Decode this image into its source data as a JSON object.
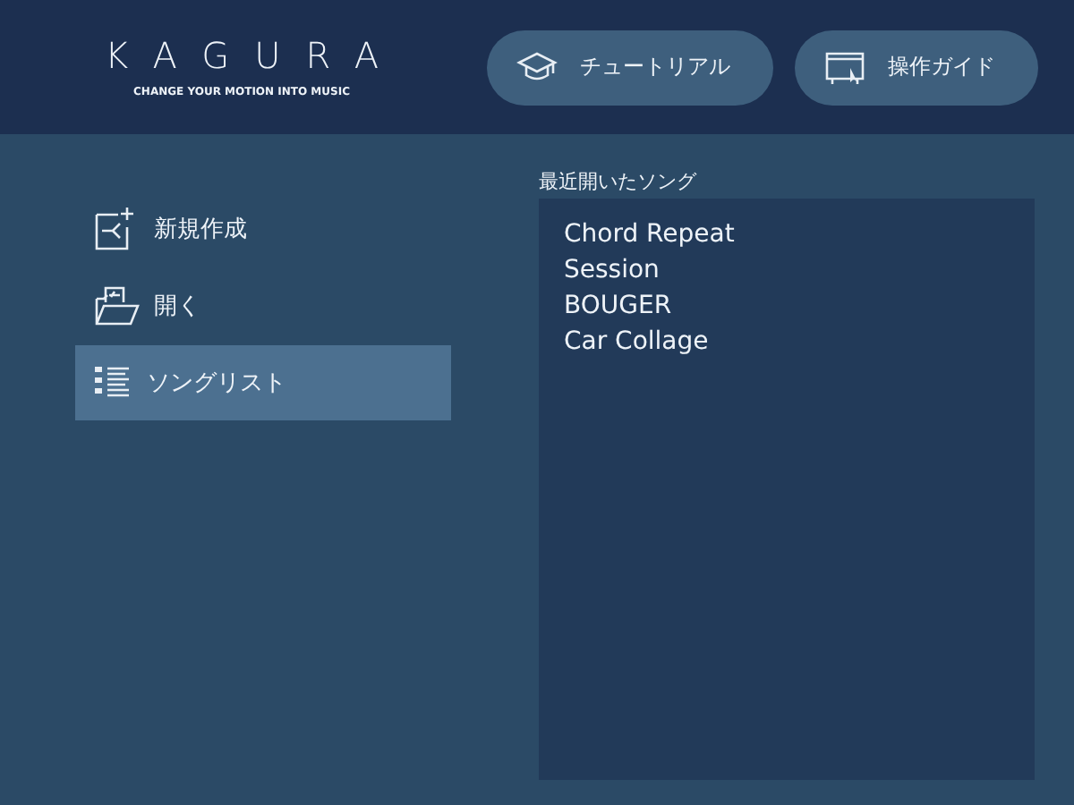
{
  "logo": {
    "wordmark": "KAGURA",
    "tagline": "CHANGE YOUR MOTION INTO MUSIC"
  },
  "header_buttons": [
    {
      "label": "チュートリアル",
      "kind": "tutorial"
    },
    {
      "label": "操作ガイド",
      "kind": "guide"
    }
  ],
  "menu": [
    {
      "label": "新規作成",
      "kind": "new",
      "selected": false
    },
    {
      "label": "開く",
      "kind": "open",
      "selected": false
    },
    {
      "label": "ソングリスト",
      "kind": "list",
      "selected": true
    }
  ],
  "recent": {
    "title": "最近開いたソング",
    "songs": [
      "Chord Repeat",
      "Session",
      "BOUGER",
      "Car Collage"
    ]
  }
}
